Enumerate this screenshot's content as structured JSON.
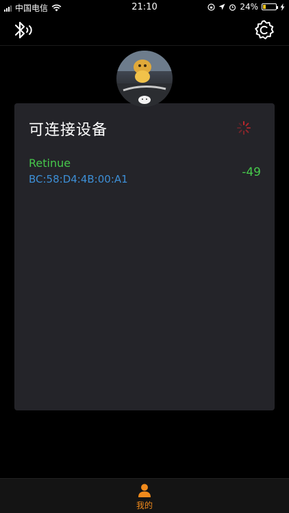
{
  "status_bar": {
    "carrier": "中国电信",
    "time": "21:10",
    "battery_percent": "24%",
    "battery_level": 0.24
  },
  "nav": {
    "left_icon": "bluetooth-icon",
    "right_icon": "settings-icon"
  },
  "card": {
    "title": "可连接设备",
    "loading_icon": "spinner-icon",
    "devices": [
      {
        "name": "Retinue",
        "address": "BC:58:D4:4B:00:A1",
        "rssi": "-49"
      }
    ]
  },
  "tab_bar": {
    "items": [
      {
        "label": "我的",
        "icon": "person-icon",
        "active": true
      }
    ],
    "accent_color": "#f08a1c"
  },
  "colors": {
    "background": "#000000",
    "card": "#242429",
    "device_name": "#46c84b",
    "device_address": "#3d8fd6"
  }
}
